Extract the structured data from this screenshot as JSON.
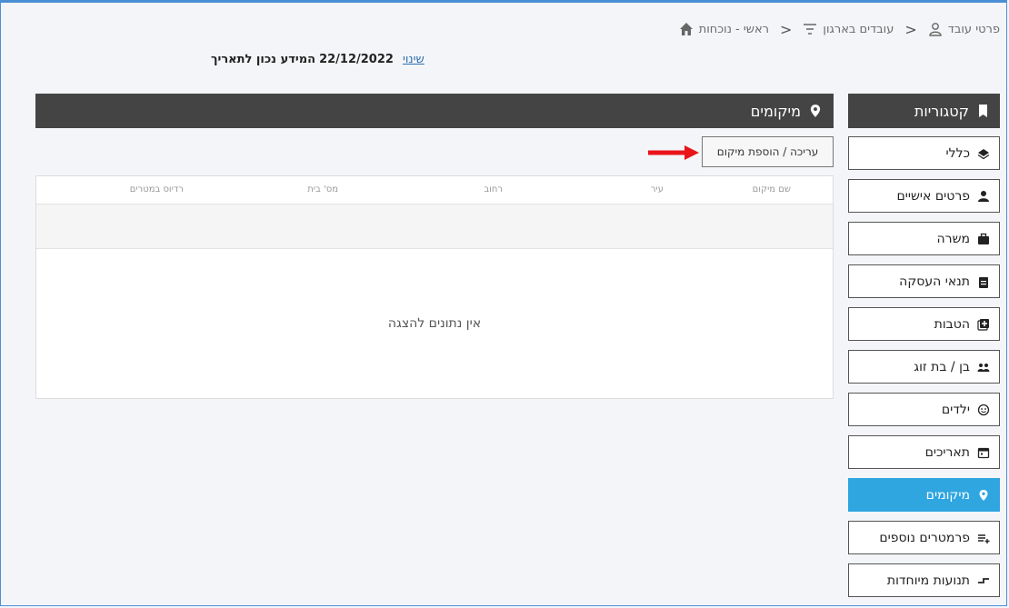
{
  "breadcrumb": {
    "home": "ראשי - נוכחות",
    "employees": "עובדים בארגון",
    "details": "פרטי עובד"
  },
  "info": {
    "text": "המידע נכון לתאריך",
    "date": "22/12/2022",
    "change": "שינוי"
  },
  "sidebar": {
    "title": "קטגוריות",
    "items": [
      {
        "label": "כללי",
        "icon": "layers-icon"
      },
      {
        "label": "פרטים אישיים",
        "icon": "person-icon"
      },
      {
        "label": "משרה",
        "icon": "briefcase-icon"
      },
      {
        "label": "תנאי העסקה",
        "icon": "clipboard-icon"
      },
      {
        "label": "הטבות",
        "icon": "plus-box-icon"
      },
      {
        "label": "בן / בת זוג",
        "icon": "couple-icon"
      },
      {
        "label": "ילדים",
        "icon": "child-icon"
      },
      {
        "label": "תאריכים",
        "icon": "calendar-icon"
      },
      {
        "label": "מיקומים",
        "icon": "location-icon"
      },
      {
        "label": "פרמטרים נוספים",
        "icon": "list-plus-icon"
      },
      {
        "label": "תנועות מיוחדות",
        "icon": "movement-icon"
      }
    ]
  },
  "panel": {
    "title": "מיקומים",
    "edit_button": "עריכה / הוספת מיקום",
    "columns": [
      "שם מיקום",
      "עיר",
      "רחוב",
      "מס' בית",
      "רדיוס במטרים"
    ],
    "empty": "אין נתונים להצגה"
  },
  "colors": {
    "active": "#2fa6e0",
    "header": "#444444",
    "arrow": "#e8141a"
  }
}
